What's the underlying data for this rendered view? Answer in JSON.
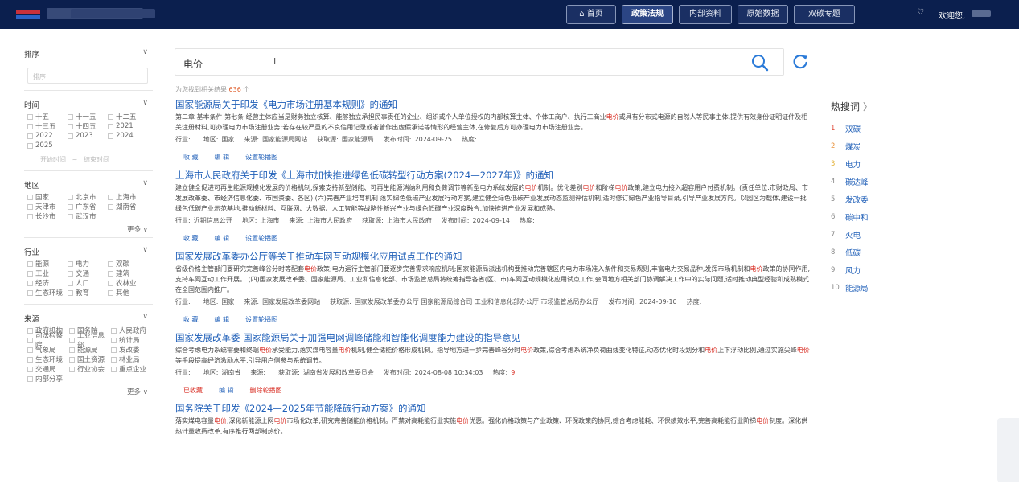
{
  "header": {
    "nav": [
      {
        "label": "首页",
        "icon": "home-icon"
      },
      {
        "label": "政策法规"
      },
      {
        "label": "内部资料"
      },
      {
        "label": "原始数据"
      },
      {
        "label": "双碳专题"
      }
    ],
    "welcome": "欢迎您,"
  },
  "sidebar": {
    "sort": {
      "title": "排序",
      "placeholder": "排序"
    },
    "time": {
      "title": "时间",
      "options": [
        "十五",
        "十一五",
        "十二五",
        "十三五",
        "十四五",
        "2021",
        "2022",
        "2023",
        "2024",
        "2025"
      ],
      "start_placeholder": "开始时间",
      "separator": "~",
      "end_placeholder": "结束时间"
    },
    "region": {
      "title": "地区",
      "options": [
        "国家",
        "北京市",
        "上海市",
        "天津市",
        "广东省",
        "湖南省",
        "长沙市",
        "武汉市"
      ],
      "more": "更多"
    },
    "industry": {
      "title": "行业",
      "options": [
        "能源",
        "电力",
        "双碳",
        "工业",
        "交通",
        "建筑",
        "经济",
        "人口",
        "农林业",
        "生态环境",
        "教育",
        "其他"
      ]
    },
    "source": {
      "title": "来源",
      "options": [
        "政府机构",
        "国务院",
        "人民政府",
        "司法检察院",
        "工业信息部",
        "统计局",
        "气象局",
        "能源局",
        "发改委",
        "生态环境",
        "国土资源",
        "林业局",
        "交通局",
        "行业协会",
        "重点企业",
        "内部分享"
      ],
      "more": "更多"
    }
  },
  "search": {
    "query": "电价",
    "found_prefix": "为您找到相关结果",
    "found_count": "636",
    "found_suffix": "个"
  },
  "results": [
    {
      "title": "国家能源局关于印发《电力市场注册基本规则》的通知",
      "body": [
        {
          "t": "第二章 基本条件 第七条 经营主体应当是财务独立核算、能够独立承担民事责任的企业、组织或个人单位授权的内部核算主体、个体工商户、执行工商业"
        },
        {
          "t": "电价",
          "hl": true
        },
        {
          "t": "或具有分布式电源的自然人等民事主体,提供有效身份证明证件及相关注册材料,可办理电力市场注册业务;若存在较严重的不良信用记录或者曾作出虚假承诺等情形的经营主体,在修复后方可办理电力市场注册业务。"
        }
      ],
      "meta": [
        {
          "k": "行业:",
          "v": ""
        },
        {
          "k": "地区:",
          "v": "国家"
        },
        {
          "k": "来源:",
          "v": "国家能源局网站"
        },
        {
          "k": "获取源:",
          "v": "国家能源局"
        },
        {
          "k": "发布时间:",
          "v": "2024-09-25"
        },
        {
          "k": "热度:",
          "v": ""
        }
      ],
      "actions": [
        "收 藏",
        "编 辑",
        "设置轮播图"
      ],
      "favorited": false
    },
    {
      "title": "上海市人民政府关于印发《上海市加快推进绿色低碳转型行动方案(2024—2027年)》的通知",
      "body": [
        {
          "t": "建立健全促进可再生能源规模化发展的价格机制,探索支持新型储能、可再生能源消纳利用和负荷调节等新型电力系统发展的"
        },
        {
          "t": "电价",
          "hl": true
        },
        {
          "t": "机制。优化差别"
        },
        {
          "t": "电价",
          "hl": true
        },
        {
          "t": "和阶梯"
        },
        {
          "t": "电价",
          "hl": true
        },
        {
          "t": "政策,建立电力接入超容用户付费机制。(责任单位:市财政局、市发展改革委、市经济信息化委、市国资委、各区) (六)完善产业培育机制 落实绿色低碳产业发展行动方案,建立健全绿色低碳产业发展动态监测评估机制,适时修订绿色产业指导目录,引导产业发展方向。以园区为载体,建设一批绿色低碳产业示范基地,推动新材料、互联网、大数据、人工智能等战略性新兴产业与绿色低碳产业深度融合,加快推进产业发展和成熟。"
        }
      ],
      "meta": [
        {
          "k": "行业:",
          "v": "近期信息公开"
        },
        {
          "k": "地区:",
          "v": "上海市"
        },
        {
          "k": "来源:",
          "v": "上海市人民政府"
        },
        {
          "k": "获取源:",
          "v": "上海市人民政府"
        },
        {
          "k": "发布时间:",
          "v": "2024-09-14"
        },
        {
          "k": "热度:",
          "v": ""
        }
      ],
      "actions": [
        "收 藏",
        "编 辑",
        "设置轮播图"
      ],
      "favorited": false
    },
    {
      "title": "国家发展改革委办公厅等关于推动车网互动规模化应用试点工作的通知",
      "body": [
        {
          "t": "省级价格主管部门要研究完善峰谷分时等配套"
        },
        {
          "t": "电价",
          "hl": true
        },
        {
          "t": "政策;电力运行主管部门要逐步完善需求响应机制;国家能源局派出机构要推动完善辖区内电力市场准入条件和交易规则,丰富电力交易品种,发挥市场机制和"
        },
        {
          "t": "电价",
          "hl": true
        },
        {
          "t": "政策的协同作用,支持车网互动工作开展。 (四)国家发展改革委、国家能源局、工业和信息化部、市场监管总局将统筹指导各省(区、市)车网互动规模化应用试点工作,会同地方相关部门协调解决工作中的实际问题,适时推动典型经验和成熟模式在全国范围内推广。"
        }
      ],
      "meta": [
        {
          "k": "行业:",
          "v": ""
        },
        {
          "k": "地区:",
          "v": "国家"
        },
        {
          "k": "来源:",
          "v": "国家发展改革委网站"
        },
        {
          "k": "获取源:",
          "v": "国家发展改革委办公厅 国家能源局综合司 工业和信息化部办公厅 市场监管总局办公厅"
        },
        {
          "k": "发布时间:",
          "v": "2024-09-10"
        },
        {
          "k": "热度:",
          "v": ""
        }
      ],
      "actions": [
        "收 藏",
        "编 辑",
        "设置轮播图"
      ],
      "favorited": false
    },
    {
      "title": "国家发展改革委 国家能源局关于加强电网调峰储能和智能化调度能力建设的指导意见",
      "body": [
        {
          "t": "综合考虑电力系统需要和终端"
        },
        {
          "t": "电价",
          "hl": true
        },
        {
          "t": "承受能力,落实煤电容量"
        },
        {
          "t": "电价",
          "hl": true
        },
        {
          "t": "机制,健全储能价格形成机制。指导地方进一步完善峰谷分时"
        },
        {
          "t": "电价",
          "hl": true
        },
        {
          "t": "政策,综合考虑系统净负荷曲线变化特征,动态优化时段划分和"
        },
        {
          "t": "电价",
          "hl": true
        },
        {
          "t": "上下浮动比例,通过实施尖峰"
        },
        {
          "t": "电价",
          "hl": true
        },
        {
          "t": "等手段提高经济激励水平,引导用户侧参与系统调节。"
        }
      ],
      "meta": [
        {
          "k": "行业:",
          "v": ""
        },
        {
          "k": "地区:",
          "v": "湖南省"
        },
        {
          "k": "来源:",
          "v": ""
        },
        {
          "k": "获取源:",
          "v": "湖南省发展和改革委员会"
        },
        {
          "k": "发布时间:",
          "v": "2024-08-08 10:34:03"
        },
        {
          "k": "热度:",
          "v": "9"
        }
      ],
      "actions": [
        "已收藏",
        "编 辑",
        "删除轮播图"
      ],
      "favorited": true
    },
    {
      "title": "国务院关于印发《2024—2025年节能降碳行动方案》的通知",
      "body": [
        {
          "t": "落实煤电容量"
        },
        {
          "t": "电价",
          "hl": true
        },
        {
          "t": ",深化新能源上网"
        },
        {
          "t": "电价",
          "hl": true
        },
        {
          "t": "市场化改革,研究完善储能价格机制。严禁对高耗能行业实施"
        },
        {
          "t": "电价",
          "hl": true
        },
        {
          "t": "优惠。强化价格政策与产业政策、环保政策的协同,综合考虑能耗、环保绩效水平,完善高耗能行业阶梯"
        },
        {
          "t": "电价",
          "hl": true
        },
        {
          "t": "制度。深化供热计量收费改革,有序推行两部制热价。"
        }
      ],
      "meta": [],
      "actions": [],
      "favorited": false
    }
  ],
  "hot": {
    "title": "热搜词",
    "items": [
      "双碳",
      "煤炭",
      "电力",
      "碳达峰",
      "发改委",
      "碳中和",
      "火电",
      "低碳",
      "风力",
      "能源局"
    ]
  }
}
